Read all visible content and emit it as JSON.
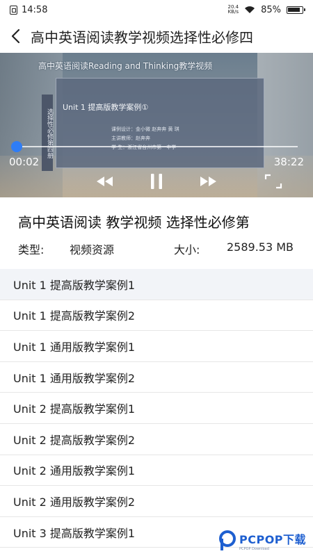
{
  "status_bar": {
    "time": "14:58",
    "net_speed_value": "20.4",
    "net_speed_unit": "KB/s",
    "battery": "85%"
  },
  "header": {
    "title": "高中英语阅读教学视频选择性必修四",
    "back_icon": "chevron-left-icon"
  },
  "video": {
    "banner": "高中英语阅读Reading and Thinking教学视频",
    "board_side": "选择性必修第四册",
    "board_title": "Unit 1  提高版教学案例①",
    "board_lines": [
      "课例设计：金小微  赵奔奔  黄 琪",
      "主讲教师：赵奔奔",
      "学    生：浙江省台州市第一中学"
    ],
    "current_time": "00:02",
    "total_time": "38:22",
    "progress": 0.0009,
    "controls": [
      "rewind-icon",
      "pause-icon",
      "fast-forward-icon",
      "fullscreen-icon"
    ]
  },
  "detail": {
    "title": "高中英语阅读 教学视频 选择性必修第",
    "type_label": "类型:",
    "type_value": "视频资源",
    "size_label": "大小:",
    "size_value": "2589.53 MB"
  },
  "list": {
    "items": [
      "Unit 1 提高版教学案例1",
      "Unit 1 提高版教学案例2",
      "Unit 1 通用版教学案例1",
      "Unit 1 通用版教学案例2",
      "Unit 2 提高版教学案例1",
      "Unit 2 提高版教学案例2",
      "Unit 2 通用版教学案例1",
      "Unit 2 通用版教学案例2",
      "Unit 3 提高版教学案例1"
    ],
    "active_index": 0
  },
  "watermark": {
    "main": "PCPOP下载",
    "sub": "PCPOP Download"
  },
  "colors": {
    "accent": "#2f7df6",
    "active_row": "#f2f4f8",
    "watermark": "#1e5fd0"
  }
}
